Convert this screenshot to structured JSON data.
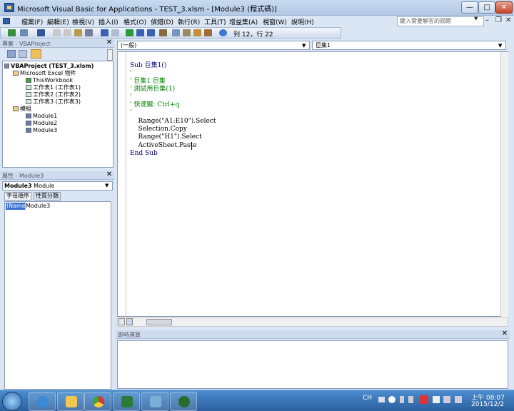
{
  "window": {
    "title": "Microsoft Visual Basic for Applications - TEST_3.xlsm - [Module3 (程式碼)]",
    "controls": {
      "minimize": "—",
      "maximize": "□",
      "close": "✕"
    }
  },
  "menu": {
    "items": [
      "檔案(F)",
      "編輯(E)",
      "檢視(V)",
      "插入(I)",
      "格式(O)",
      "偵錯(D)",
      "執行(R)",
      "工具(T)",
      "增益集(A)",
      "視窗(W)",
      "說明(H)"
    ],
    "ask_placeholder": "鍵入需要解答的問題",
    "mdi": {
      "minimize": "–",
      "restore": "❐",
      "close": "✕"
    }
  },
  "toolbar": {
    "position": "列 12，行 22"
  },
  "project": {
    "header": "專案 - VBAProject",
    "root": "VBAProject (TEST_3.xlsm)",
    "excel_objects": "Microsoft Excel 物件",
    "objects": [
      "ThisWorkbook",
      "工作表1 (工作表1)",
      "工作表2 (工作表2)",
      "工作表3 (工作表3)"
    ],
    "modules_folder": "模組",
    "modules": [
      "Module1",
      "Module2",
      "Module3"
    ]
  },
  "properties": {
    "header": "屬性 - Module3",
    "selected_bold": "Module3",
    "selected_type": "Module",
    "tabs": [
      "字母順序",
      "性質分類"
    ],
    "name_label": "(Name)",
    "name_value": "Module3"
  },
  "code": {
    "object_combo": "(一般)",
    "proc_combo": "巨集1",
    "lines": [
      "Sub 巨集1()",
      "'",
      "' 巨集1 巨集",
      "' 測試用巨集(1)",
      "'",
      "' 快速鍵: Ctrl+q",
      "'",
      "    Range(\"A1:E10\").Select",
      "    Selection.Copy",
      "    Range(\"H1\").Select",
      "    ActiveSheet.Paste",
      "End Sub"
    ]
  },
  "immediate": {
    "header": "即時運算"
  },
  "taskbar": {
    "tray": "CH",
    "time": "上午 08:07",
    "date": "2015/12/2"
  },
  "colors": {
    "keyword": "#00007f",
    "comment": "#008000"
  }
}
